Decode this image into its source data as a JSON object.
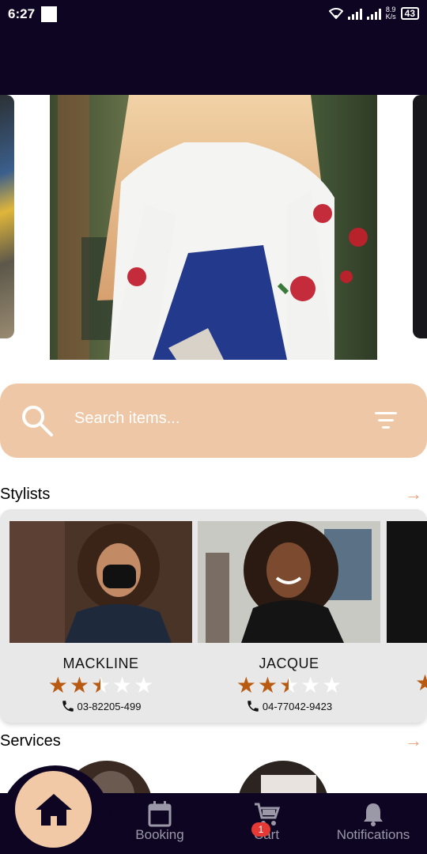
{
  "status_bar": {
    "time": "6:27",
    "net_speed_top": "8.9",
    "net_speed_bottom": "K/s",
    "battery": "43"
  },
  "search": {
    "placeholder": "Search items..."
  },
  "sections": {
    "stylists_title": "Stylists",
    "services_title": "Services"
  },
  "stylists": [
    {
      "name": "MACKLINE",
      "rating": 2.5,
      "phone": "03-82205-499"
    },
    {
      "name": "JACQUE",
      "rating": 2.5,
      "phone": "04-77042-9423"
    }
  ],
  "bottom_nav": {
    "items": [
      {
        "label": "Booking"
      },
      {
        "label": "Cart",
        "badge": "1"
      },
      {
        "label": "Notifications"
      }
    ]
  },
  "colors": {
    "dark": "#0e0522",
    "peach": "#eec7a6",
    "star": "#b85a12",
    "arrow": "#e8a27a"
  }
}
